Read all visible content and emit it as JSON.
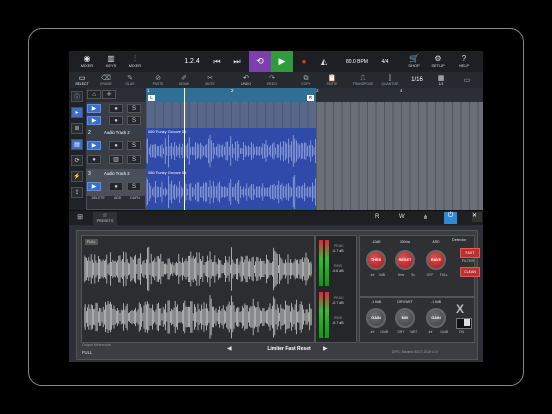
{
  "toolbar": {
    "items": [
      {
        "id": "mixer",
        "label": "MIXER",
        "icon": "mixer-icon"
      },
      {
        "id": "keys",
        "label": "KEYS",
        "icon": "keys-icon"
      },
      {
        "id": "mixer2",
        "label": "MIXER",
        "icon": "sliders-icon"
      }
    ],
    "position": "1.2.4",
    "bpm": "80.0 BPM",
    "signature": "4/4",
    "right": [
      {
        "id": "shop",
        "label": "SHOP",
        "badge": "4"
      },
      {
        "id": "setup",
        "label": "SETUP"
      },
      {
        "id": "help",
        "label": "HELP"
      }
    ]
  },
  "secondbar": {
    "items": [
      "SELECT",
      "ERASE",
      "GLUE",
      "PASTE",
      "DRAW",
      "MUTE",
      "UNDO",
      "REDO",
      "COPY",
      "PASTE",
      "TRANSPOSE",
      "QUANTIZE"
    ],
    "grid_value": "1/16",
    "grid_label": "1/4"
  },
  "ruler": {
    "marks": [
      "1",
      "2",
      "3",
      "4"
    ],
    "loop_start": "L",
    "loop_end": "R"
  },
  "tracks": [
    {
      "num": "1",
      "name": "",
      "clip": ""
    },
    {
      "num": "2",
      "name": "Audio Track 2",
      "clip": "080 Funky Groove 01"
    },
    {
      "num": "3",
      "name": "Audio Track 2",
      "clip": "080 Funky Groove 01"
    }
  ],
  "track_bottom": {
    "delete": "DELETE",
    "add": "ADD",
    "duplicate": "DUPLI"
  },
  "fx_tabs": {
    "presets": "PRESETS",
    "icons": [
      "R",
      "W",
      "routing",
      "power"
    ]
  },
  "plugin": {
    "mode_label": "FULL",
    "preset_name": "Limiter Fast Reset",
    "output_label": "Output Metercode",
    "footer_right": "DFRC Maxima 00017-2018 v1.0",
    "meters": [
      {
        "label": "PEAK",
        "value": "-0.7 dB"
      },
      {
        "label": "RMS",
        "value": "-9.6 dB"
      },
      {
        "label": "PEAK",
        "value": "-0.7 dB"
      },
      {
        "label": "RMS",
        "value": "-9.7 dB"
      }
    ],
    "knobs_top": [
      {
        "title": "-10dB",
        "label": "THRS",
        "min": "-inf",
        "max": "0dB"
      },
      {
        "title": "300ms",
        "label": "RESET",
        "min": "5ms",
        "max": "5s"
      },
      {
        "title": "ARD",
        "label": "RAVE",
        "min": "OFF",
        "max": "FULL"
      }
    ],
    "knobs_bottom": [
      {
        "title": "-1.5dB",
        "label": "GAIN",
        "min": "-inf",
        "max": "10dB"
      },
      {
        "title": "DRY/WET",
        "label": "MIX",
        "min": "DRY",
        "max": "WET"
      },
      {
        "title": "-1.5dB",
        "label": "GAIN",
        "min": "-inf",
        "max": "10dB"
      }
    ],
    "detector": "Detector",
    "fast": "FAST",
    "filter": "FILTER",
    "clean": "CLEAN",
    "on": "ON",
    "tab": "FULL"
  }
}
